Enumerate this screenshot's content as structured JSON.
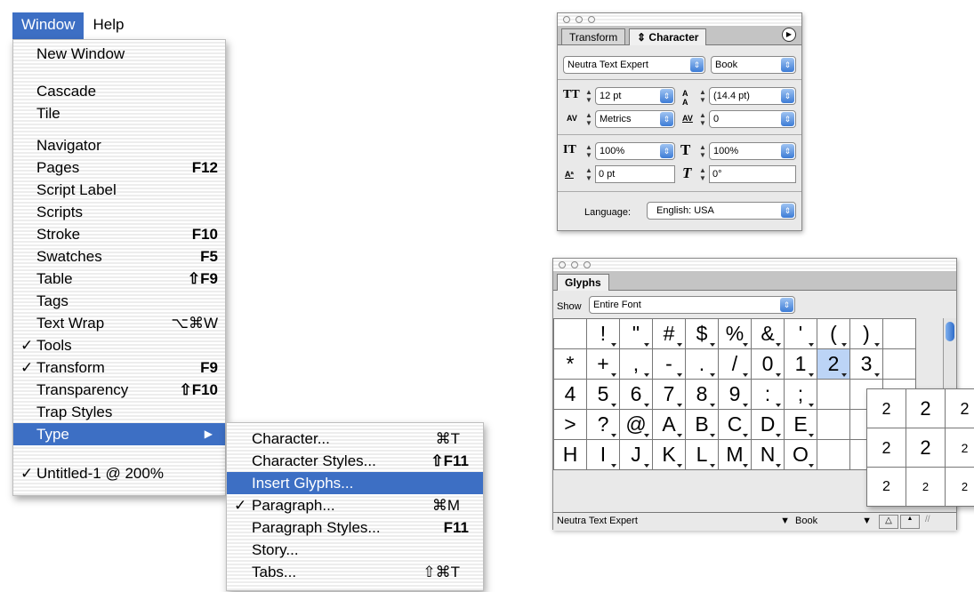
{
  "menubar": {
    "window": "Window",
    "help": "Help"
  },
  "window_menu": {
    "items": [
      {
        "label": "New Window",
        "shortcut": "",
        "check": ""
      },
      {
        "label": "Cascade",
        "shortcut": "",
        "check": ""
      },
      {
        "label": "Tile",
        "shortcut": "",
        "check": ""
      },
      {
        "label": "Navigator",
        "shortcut": "",
        "check": ""
      },
      {
        "label": "Pages",
        "shortcut": "F12",
        "check": ""
      },
      {
        "label": "Script Label",
        "shortcut": "",
        "check": ""
      },
      {
        "label": "Scripts",
        "shortcut": "",
        "check": ""
      },
      {
        "label": "Stroke",
        "shortcut": "F10",
        "check": ""
      },
      {
        "label": "Swatches",
        "shortcut": "F5",
        "check": ""
      },
      {
        "label": "Table",
        "shortcut": "⇧F9",
        "check": ""
      },
      {
        "label": "Tags",
        "shortcut": "",
        "check": ""
      },
      {
        "label": "Text Wrap",
        "shortcut": "⌥⌘W",
        "check": ""
      },
      {
        "label": "Tools",
        "shortcut": "",
        "check": "✓"
      },
      {
        "label": "Transform",
        "shortcut": "F9",
        "check": "✓"
      },
      {
        "label": "Transparency",
        "shortcut": "⇧F10",
        "check": ""
      },
      {
        "label": "Trap Styles",
        "shortcut": "",
        "check": ""
      },
      {
        "label": "Type",
        "shortcut": "▶",
        "check": ""
      },
      {
        "label": "Untitled-1 @ 200%",
        "shortcut": "",
        "check": "✓"
      }
    ]
  },
  "type_submenu": {
    "items": [
      {
        "label": "Character...",
        "shortcut": "⌘T",
        "check": ""
      },
      {
        "label": "Character Styles...",
        "shortcut": "⇧F11",
        "check": ""
      },
      {
        "label": "Insert Glyphs...",
        "shortcut": "",
        "check": ""
      },
      {
        "label": "Paragraph...",
        "shortcut": "⌘M",
        "check": "✓"
      },
      {
        "label": "Paragraph Styles...",
        "shortcut": "F11",
        "check": ""
      },
      {
        "label": "Story...",
        "shortcut": "",
        "check": ""
      },
      {
        "label": "Tabs...",
        "shortcut": "⇧⌘T",
        "check": ""
      }
    ]
  },
  "character_panel": {
    "tabs": {
      "transform": "Transform",
      "character": "Character"
    },
    "tab_icon": "⇕",
    "font_family": "Neutra Text Expert",
    "font_style": "Book",
    "font_size": "12 pt",
    "leading": "(14.4 pt)",
    "kerning": "Metrics",
    "tracking": "0",
    "vertical_scale": "100%",
    "horizontal_scale": "100%",
    "baseline_shift": "0 pt",
    "skew": "0°",
    "language_label": "Language:",
    "language": "English: USA"
  },
  "glyphs_panel": {
    "tab": "Glyphs",
    "show_label": "Show",
    "show_value": "Entire Font",
    "glyphs": [
      "",
      "!",
      "\"",
      "#",
      "$",
      "%",
      "&",
      "'",
      "(",
      ")",
      "",
      "*",
      "+",
      ",",
      "-",
      ".",
      "/",
      "0",
      "1",
      "2",
      "3",
      "",
      "4",
      "5",
      "6",
      "7",
      "8",
      "9",
      ":",
      ";",
      "",
      "",
      "",
      ">",
      "?",
      "@",
      "A",
      "B",
      "C",
      "D",
      "E",
      "",
      "",
      "",
      "H",
      "I",
      "J",
      "K",
      "L",
      "M",
      "N",
      "O",
      "",
      "",
      ""
    ],
    "alternates": [
      "2",
      "2",
      "2",
      "2",
      "2",
      "2",
      "2",
      "2",
      "2"
    ],
    "footer_font": "Neutra Text Expert",
    "footer_style": "Book"
  },
  "colors": {
    "highlight": "#3d6fc4",
    "glyph_selected": "#bcd4f6",
    "popup_arrow": "#3d7cd6"
  }
}
